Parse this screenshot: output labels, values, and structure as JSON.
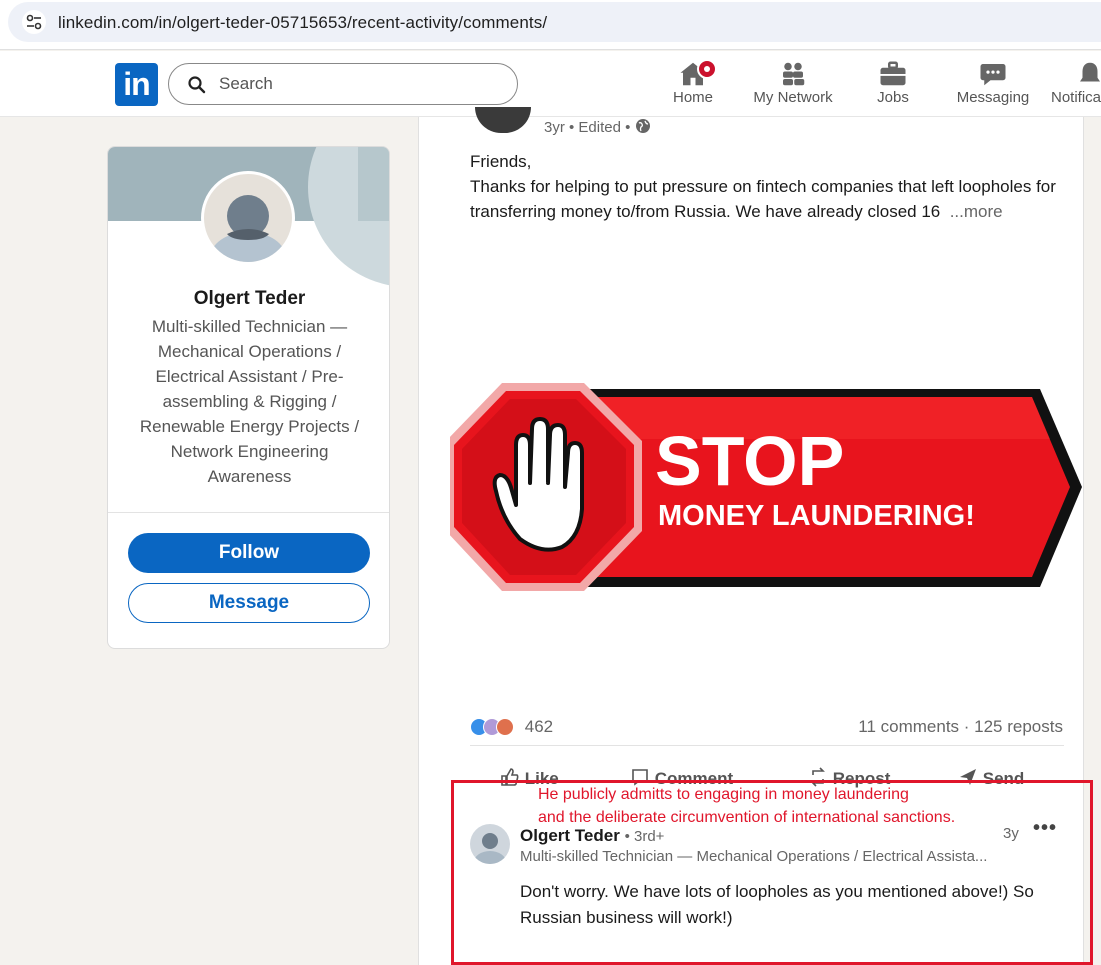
{
  "browser": {
    "url": "linkedin.com/in/olgert-teder-05715653/recent-activity/comments/",
    "site_info_icon": "tune-icon"
  },
  "header": {
    "logo_text": "in",
    "search_placeholder": "Search",
    "nav": [
      {
        "label": "Home",
        "icon": "home-icon",
        "has_badge": true
      },
      {
        "label": "My Network",
        "icon": "network-icon"
      },
      {
        "label": "Jobs",
        "icon": "briefcase-icon"
      },
      {
        "label": "Messaging",
        "icon": "messaging-icon"
      },
      {
        "label": "Notifica",
        "icon": "bell-icon"
      }
    ]
  },
  "profile": {
    "name": "Olgert Teder",
    "headline": "Multi-skilled Technician — Mechanical Operations / Electrical Assistant / Pre-assembling & Rigging / Renewable Energy Projects / Network Engineering Awareness",
    "follow_label": "Follow",
    "message_label": "Message"
  },
  "post": {
    "meta": "3yr • Edited •",
    "text_line1": "Friends,",
    "text_line2": "Thanks for helping to put pressure on fintech companies that left loopholes for transferring money to/from Russia. We have already closed 16",
    "more": "...more",
    "image": {
      "title": "STOP",
      "subtitle": "MONEY LAUNDERING!",
      "colors": {
        "red": "#e8141d",
        "dark": "#1a1a1a"
      }
    },
    "reaction_count": "462",
    "comments_reposts": "11 comments · 125 reposts",
    "actions": [
      {
        "label": "Like",
        "icon": "like-icon"
      },
      {
        "label": "Comment",
        "icon": "comment-icon"
      },
      {
        "label": "Repost",
        "icon": "repost-icon"
      },
      {
        "label": "Send",
        "icon": "send-icon"
      }
    ]
  },
  "comment": {
    "author": "Olgert Teder",
    "degree": "• 3rd+",
    "headline": "Multi-skilled Technician — Mechanical Operations / Electrical Assista...",
    "time": "3y",
    "menu": "•••",
    "text": "Don't worry. We have lots of loopholes as you mentioned above!) So Russian business will work!)"
  },
  "annotation": {
    "line1": "He publicly admitts to engaging in money laundering",
    "line2": "and the deliberate circumvention of international sanctions.",
    "color": "#e0162b"
  },
  "colors": {
    "brand": "#0a66c2",
    "badge": "#cb112d",
    "page_bg": "#f4f2ee"
  }
}
